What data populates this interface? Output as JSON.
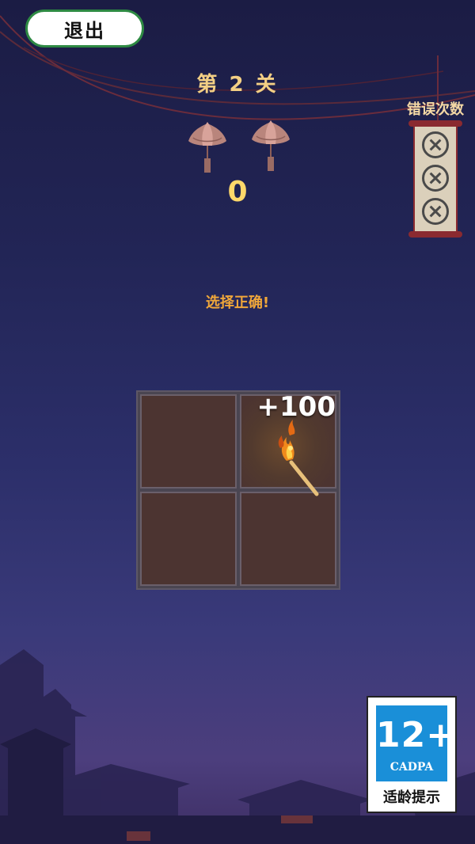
{
  "header": {
    "exit_label": "退出",
    "level_title": "第 2 关",
    "score": "0"
  },
  "errors": {
    "label": "错误次数",
    "max_count": 3,
    "icon": "x-circle-icon"
  },
  "game": {
    "hint": "选择正确!",
    "floating_score": "+100",
    "cells": [
      {
        "state": "revealed",
        "item": "match-icon"
      },
      {
        "state": "hidden"
      },
      {
        "state": "hidden"
      },
      {
        "state": "hidden"
      }
    ]
  },
  "age_rating": {
    "age": "12+",
    "org": "CADPA",
    "tip": "适龄提示"
  },
  "colors": {
    "title": "#f3cf84",
    "score": "#ffd86a",
    "hint": "#f0a73a",
    "exit_border": "#2e8a43",
    "rating_blue": "#1a8fd8"
  }
}
